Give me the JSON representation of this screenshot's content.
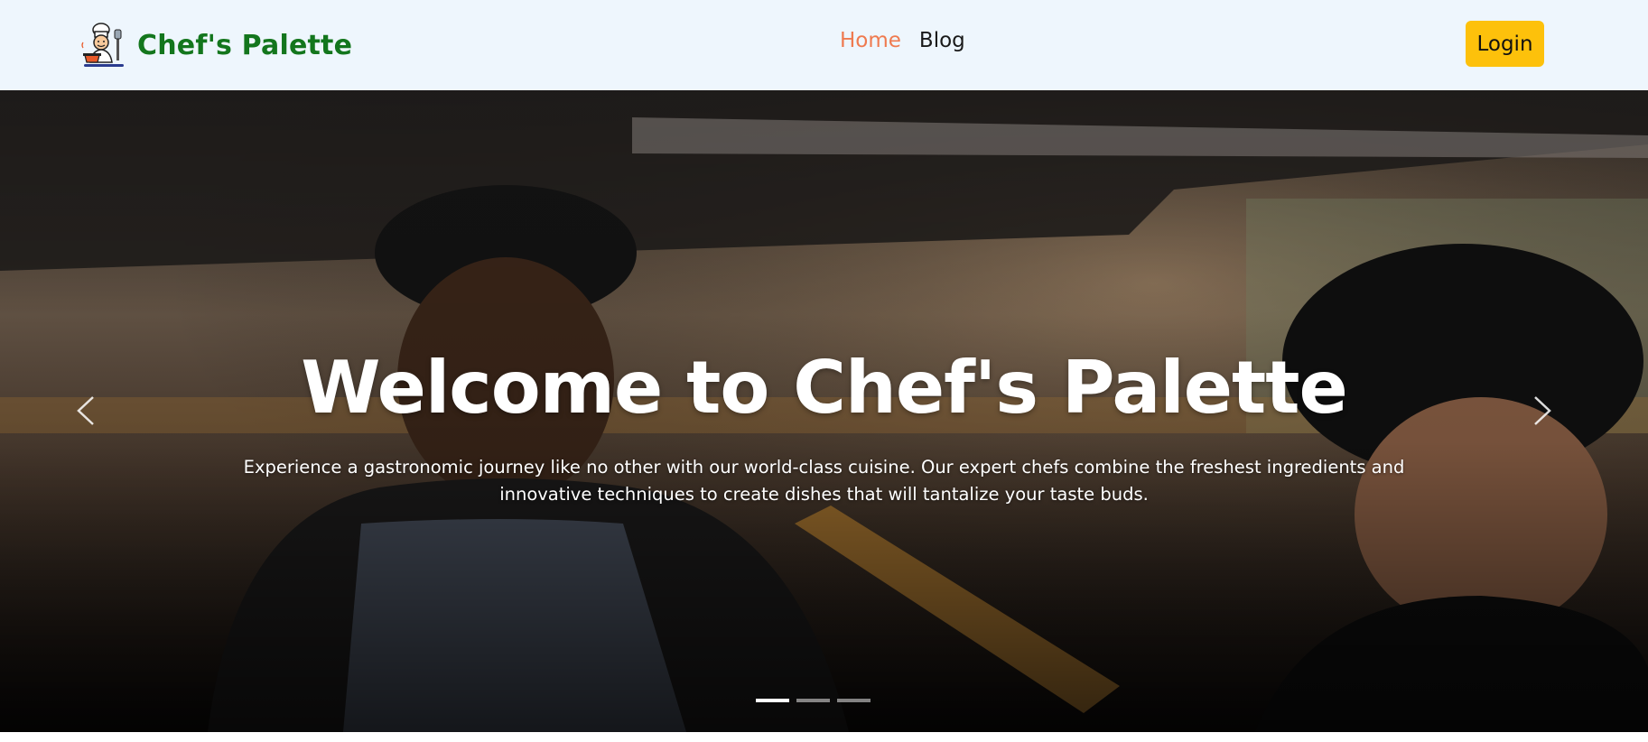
{
  "brand": {
    "name": "Chef's Palette",
    "logo_icon": "chef-cooking-logo"
  },
  "nav": {
    "links": [
      {
        "label": "Home",
        "active": true
      },
      {
        "label": "Blog",
        "active": false
      }
    ],
    "login_label": "Login"
  },
  "hero": {
    "title": "Welcome to Chef's Palette",
    "text": "Experience a gastronomic journey like no other with our world-class cuisine. Our expert chefs combine the freshest ingredients and innovative techniques to create dishes that will tantalize your taste buds.",
    "prev_icon": "chevron-left-icon",
    "next_icon": "chevron-right-icon",
    "slide_count": 3,
    "active_slide": 1
  },
  "colors": {
    "navbar_bg": "#eef6fd",
    "brand_green": "#13761d",
    "active_link": "#ef7a4f",
    "login_yellow": "#fdc10b"
  }
}
